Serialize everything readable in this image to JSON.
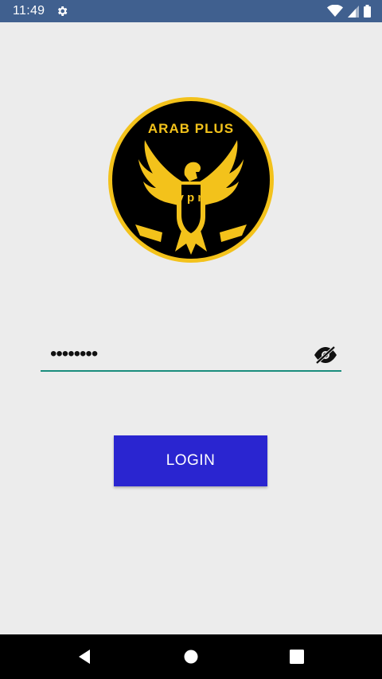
{
  "status_bar": {
    "time": "11:49",
    "icons": [
      "settings-icon",
      "wifi-icon",
      "signal-icon",
      "battery-icon"
    ]
  },
  "logo": {
    "text_top": "ARAB PLUS",
    "text_vertical": "vpn",
    "colors": {
      "ring": "#f3c21b",
      "background": "#000000",
      "emblem": "#f3c21b"
    }
  },
  "password_field": {
    "value_masked": "••••••••",
    "toggle_icon": "eye-off-icon",
    "accent_color": "#1a8d7d"
  },
  "login_button": {
    "label": "LOGIN",
    "color": "#2a25d0"
  },
  "nav_bar": {
    "buttons": [
      "back-icon",
      "home-icon",
      "recents-icon"
    ]
  }
}
